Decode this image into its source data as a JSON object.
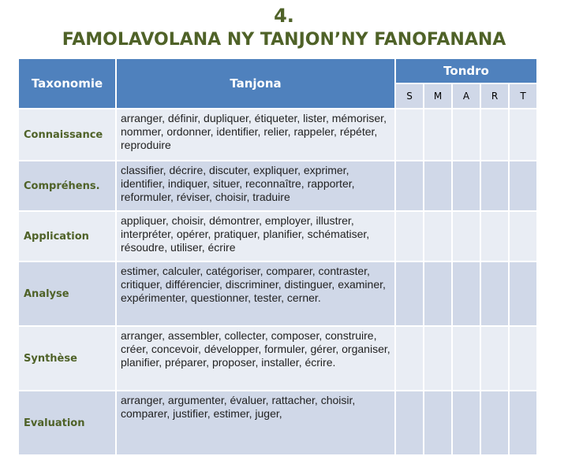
{
  "title": {
    "number": "4.",
    "text": "FAMOLAVOLANA NY TANJON’NY  FANOFANANA"
  },
  "table": {
    "headers": {
      "taxonomie": "Taxonomie",
      "tanjona": "Tanjona",
      "tondro": "Tondro",
      "smart": [
        "S",
        "M",
        "A",
        "R",
        "T"
      ]
    },
    "rows": [
      {
        "taxonomie": "Connaissance",
        "tanjona": "arranger, définir, dupliquer, étiqueter, lister, mémoriser, nommer, ordonner, identifier, relier, rappeler, répéter, reproduire",
        "smart": [
          "",
          "",
          "",
          "",
          ""
        ]
      },
      {
        "taxonomie": "Compréhens.",
        "tanjona": "classifier, décrire, discuter, expliquer, exprimer, identifier, indiquer, situer, reconnaître, rapporter, reformuler, réviser, choisir, traduire",
        "smart": [
          "",
          "",
          "",
          "",
          ""
        ]
      },
      {
        "taxonomie": "Application",
        "tanjona": "appliquer, choisir, démontrer, employer, illustrer, interpréter, opérer, pratiquer, planifier, schématiser, résoudre, utiliser, écrire",
        "smart": [
          "",
          "",
          "",
          "",
          ""
        ]
      },
      {
        "taxonomie": "Analyse",
        "tanjona": "estimer, calculer, catégoriser, comparer, contraster, critiquer, différencier, discriminer, distinguer, examiner, expérimenter, questionner, tester, cerner.",
        "smart": [
          "",
          "",
          "",
          "",
          ""
        ]
      },
      {
        "taxonomie": "Synthèse",
        "tanjona": "arranger, assembler, collecter, composer, construire, créer, concevoir, développer, formuler, gérer, organiser, planifier, préparer, proposer, installer, écrire.",
        "smart": [
          "",
          "",
          "",
          "",
          ""
        ]
      },
      {
        "taxonomie": "Evaluation",
        "tanjona": "arranger, argumenter, évaluer, rattacher, choisir, comparer, justifier, estimer, juger,",
        "smart": [
          "",
          "",
          "",
          "",
          ""
        ]
      }
    ]
  },
  "colors": {
    "header_bg": "#4f81bd",
    "header_text": "#ffffff",
    "title_text": "#4f6228",
    "row_light": "#e9edf4",
    "row_dark": "#d0d8e8",
    "taxonomy_text": "#4f6228"
  }
}
